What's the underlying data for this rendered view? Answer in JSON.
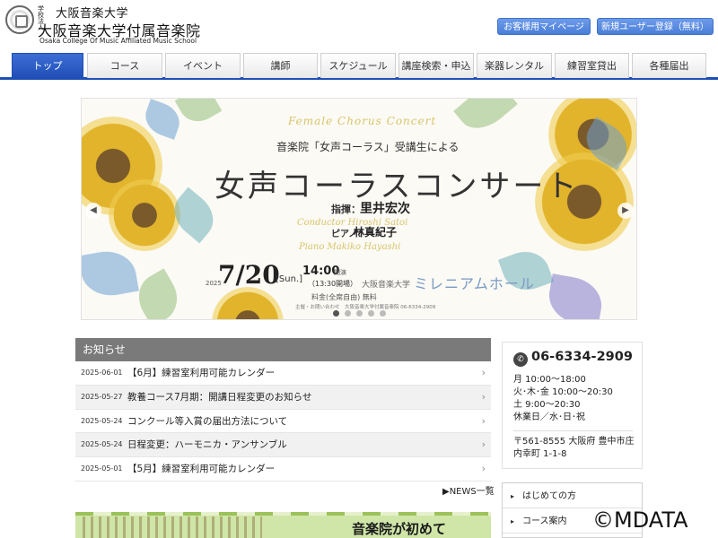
{
  "header": {
    "logo_corp": "学校法人",
    "logo_line1": "大阪音楽大学",
    "logo_line2": "大阪音楽大学付属音楽院",
    "logo_en": "Osaka College Of Music Affiliated Music School",
    "mypage_label": "お客様用マイページ",
    "register_label": "新規ユーザー登録（無料）"
  },
  "nav": {
    "items": [
      {
        "label": "トップ",
        "active": true
      },
      {
        "label": "コース"
      },
      {
        "label": "イベント"
      },
      {
        "label": "講師"
      },
      {
        "label": "スケジュール"
      },
      {
        "label": "講座検索・申込"
      },
      {
        "label": "楽器レンタル"
      },
      {
        "label": "練習室貸出"
      },
      {
        "label": "各種届出"
      }
    ]
  },
  "hero": {
    "en_title": "Female Chorus Concert",
    "subtitle": "音楽院「女声コーラス」受講生による",
    "title": "女声コーラスコンサート",
    "conductor_label": "指揮：",
    "conductor_name": "里井宏次",
    "conductor_en": "Conductor Hiroshi Satoi",
    "piano_label": "ピアノ：",
    "piano_name": "林真紀子",
    "piano_en": "Piano Makiko Hayashi",
    "year": "2025",
    "date": "7/20",
    "day": "[Sun.]",
    "time": "14:00",
    "time_note": "開演",
    "open_time": "（13:30開場）",
    "venue_prefix": "大阪音楽大学",
    "venue": "ミレニアムホール",
    "admission": "料金(全席自由) 無料",
    "contact": "主催・お問い合わせ　大阪音楽大学付属音楽院 06-6334-2909",
    "slides": 5,
    "active_slide": 0
  },
  "news": {
    "heading": "お知らせ",
    "items": [
      {
        "date": "2025-06-01",
        "text": "【6月】練習室利用可能カレンダー"
      },
      {
        "date": "2025-05-27",
        "text": "教養コース7月期：開講日程変更のお知らせ"
      },
      {
        "date": "2025-05-24",
        "text": "コンクール等入賞の届出方法について"
      },
      {
        "date": "2025-05-24",
        "text": "日程変更：ハーモニカ・アンサンブル"
      },
      {
        "date": "2025-05-01",
        "text": "【5月】練習室利用可能カレンダー"
      }
    ],
    "more_label": "▶NEWS一覧"
  },
  "info": {
    "tel": "06-6334-2909",
    "hours": [
      "月 10:00〜18:00",
      "火･木･金 10:00〜20:30",
      "土 9:00〜20:30",
      "休業日／水･日･祝"
    ],
    "address_line1": "〒561-8555 大阪府 豊中市庄",
    "address_line2": "内幸町 1-1-8"
  },
  "side_menu": {
    "items": [
      "はじめての方",
      "コース案内"
    ]
  },
  "banner": {
    "text": "音楽院が初めて"
  },
  "watermark": "©MDATA"
}
